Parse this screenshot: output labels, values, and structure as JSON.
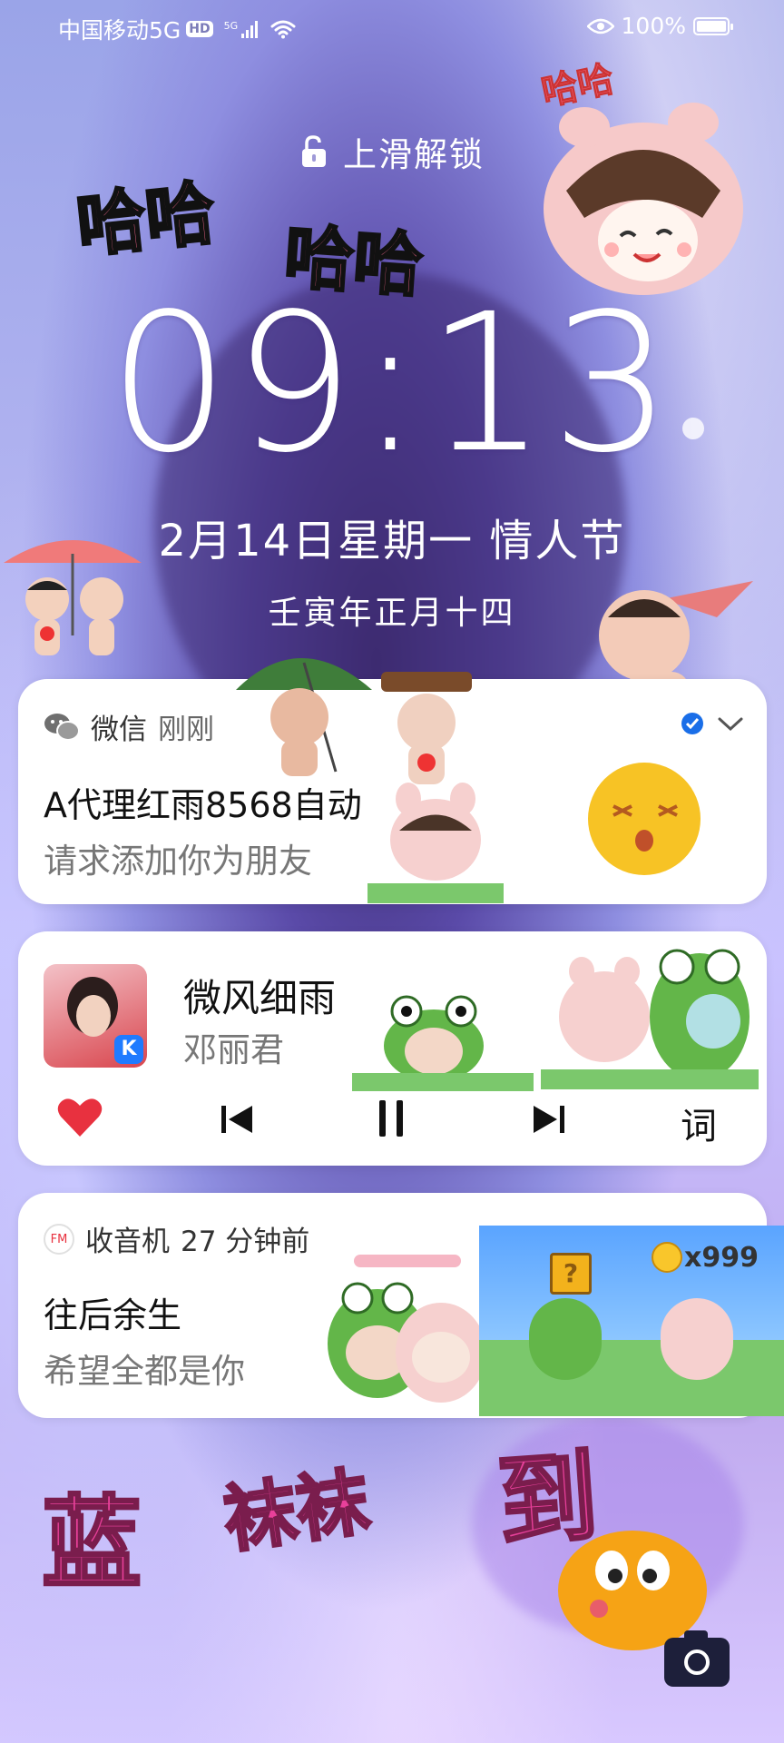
{
  "status_bar": {
    "carrier": "中国移动5G",
    "hd_badge": "HD",
    "net_type": "5G",
    "battery_percent": "100%",
    "battery_level": 1.0
  },
  "lockscreen": {
    "unlock_hint": "上滑解锁",
    "time": "09:13",
    "date": "2月14日星期一  情人节",
    "lunar_date": "壬寅年正月十四"
  },
  "notifications": {
    "wechat": {
      "app": "微信",
      "time": "刚刚",
      "title": "A代理红雨8568自动",
      "body": "请求添加你为朋友"
    },
    "music": {
      "song": "微风细雨",
      "artist": "邓丽君",
      "lyrics_label": "词"
    },
    "radio": {
      "app": "收音机",
      "time": "27 分钟前",
      "title": "往后余生",
      "body": "希望全都是你",
      "fm_badge": "FM"
    }
  },
  "stickers": {
    "haha_top": "哈哈",
    "haha_left": "哈哈",
    "haha_mid": "哈哈",
    "coin_count": "x999",
    "blue_word": "蓝",
    "mid_word": "袜袜",
    "dao_word": "到"
  },
  "icons": {
    "wifi": "wifi-icon",
    "eye": "eye-icon",
    "lock": "unlock-icon",
    "camera": "camera-icon"
  },
  "colors": {
    "heart": "#e8313f",
    "sticker_pink": "#e8409a",
    "verified": "#1a6ee8"
  }
}
